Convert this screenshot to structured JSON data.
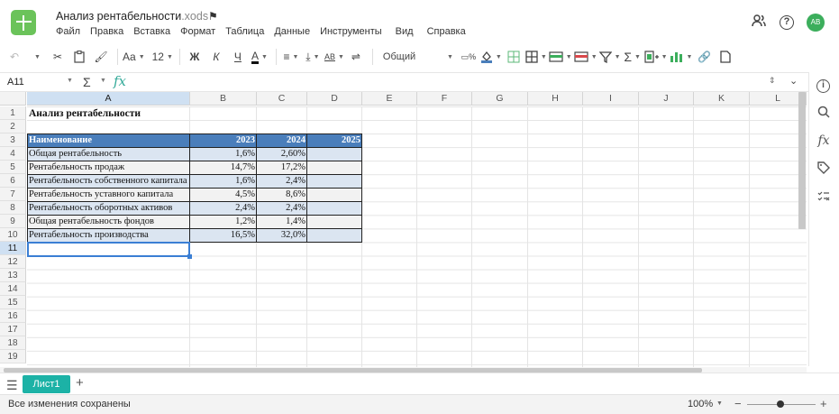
{
  "app": {
    "doc_name": "Анализ рентабельности",
    "doc_ext": ".xods",
    "menu": [
      "Файл",
      "Правка",
      "Вставка",
      "Формат",
      "Таблица",
      "Данные",
      "Инструменты",
      "Вид",
      "Справка"
    ],
    "avatar_initials": "AB"
  },
  "toolbar": {
    "font_name_label": "Aa",
    "font_size": "12",
    "bold": "Ж",
    "italic": "К",
    "underline": "Ч",
    "text_color_glyph": "A",
    "wrap_glyph": "AB",
    "number_format": "Общий",
    "sum_glyph": "Σ"
  },
  "formula_bar": {
    "cell_ref": "A11",
    "sum_glyph": "Σ",
    "fx": "fx",
    "value": ""
  },
  "columns": [
    "A",
    "B",
    "C",
    "D",
    "E",
    "F",
    "G",
    "H",
    "I",
    "J",
    "K",
    "L"
  ],
  "rows": [
    "1",
    "2",
    "3",
    "4",
    "5",
    "6",
    "7",
    "8",
    "9",
    "10",
    "11",
    "12",
    "13",
    "14",
    "15",
    "16",
    "17",
    "18",
    "19"
  ],
  "sheet": {
    "title": "Анализ рентабельности",
    "header": [
      "Наименование",
      "2023",
      "2024",
      "2025"
    ],
    "data_rows": [
      {
        "name": "Общая рентабельность",
        "y2023": "1,6%",
        "y2024": "2,60%",
        "y2025": ""
      },
      {
        "name": "Рентабельность продаж",
        "y2023": "14,7%",
        "y2024": "17,2%",
        "y2025": ""
      },
      {
        "name": "Рентабельность собственного капитала",
        "y2023": "1,6%",
        "y2024": "2,4%",
        "y2025": ""
      },
      {
        "name": "Рентабельность уставного капитала",
        "y2023": "4,5%",
        "y2024": "8,6%",
        "y2025": ""
      },
      {
        "name": "Рентабельность оборотных активов",
        "y2023": "2,4%",
        "y2024": "2,4%",
        "y2025": ""
      },
      {
        "name": "Общая рентабельность фондов",
        "y2023": "1,2%",
        "y2024": "1,4%",
        "y2025": ""
      },
      {
        "name": "Рентабельность производства",
        "y2023": "16,5%",
        "y2024": "32,0%",
        "y2025": ""
      }
    ]
  },
  "tabs": {
    "active": "Лист1"
  },
  "status": {
    "message": "Все изменения сохранены",
    "zoom": "100%"
  },
  "colors": {
    "accent": "#1cb2a6",
    "header_fill": "#4a7ebb",
    "band_fill": "#dbe5f1",
    "selection": "#3b7fd4"
  }
}
